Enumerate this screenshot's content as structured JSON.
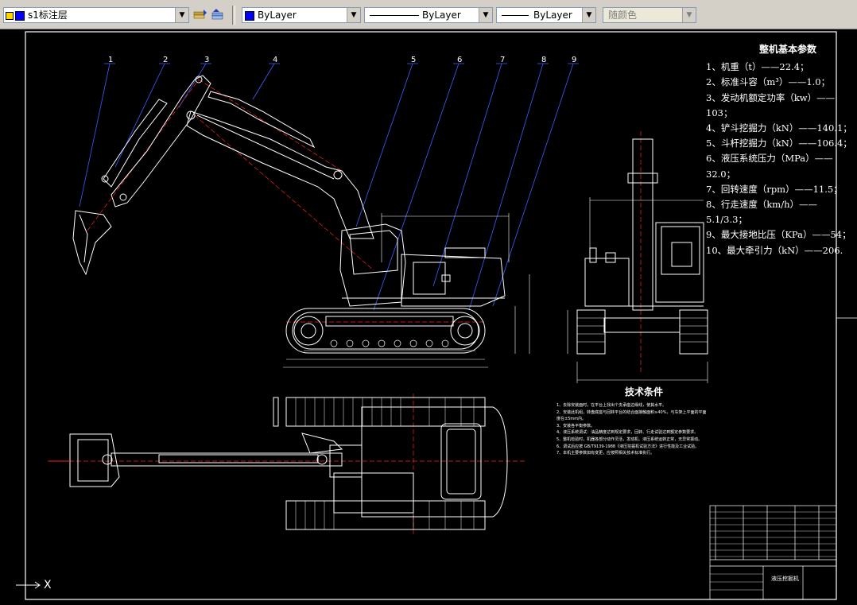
{
  "toolbar": {
    "layer_name": "s1标注层",
    "color": "ByLayer",
    "linetype": "ByLayer",
    "lineweight": "ByLayer",
    "plotstyle": "随颜色"
  },
  "drawing": {
    "part_numbers": [
      "1",
      "2",
      "3",
      "4",
      "5",
      "6",
      "7",
      "8",
      "9"
    ],
    "params_title": "整机基本参数",
    "params": [
      "1、机重（t）——22.4；",
      "2、标准斗容（m³）——1.0；",
      "3、发动机额定功率（kw）——103；",
      "4、铲斗挖掘力（kN）——140.1；",
      "5、斗杆挖掘力（kN）——106.4；",
      "6、液压系统压力（MPa）——32.0；",
      "7、回转速度（rpm）——11.5；",
      "8、行走速度（km/h）——5.1/3.3；",
      "9、最大接地比压（KPa）——54；",
      "10、最大牵引力（kN）——206."
    ],
    "tech_title": "技术条件",
    "tech_items": [
      "1、去除安装面时，在平台上找出个支承座边缘线，使其水平。",
      "2、安装此机组，转盘底座与回转平台的结合面接触面积≥40%，与车架上平面的平面度在±5mm内。",
      "3、安装各平衡参数。",
      "4、液压系统调试：油品精度达到规定要求，回转、行走试验达到额定参数要求。",
      "5、整机检验时，机器各部分动作灵活，发动机、液压系统运转正常，无异常振动。",
      "6、调试后应按 GB/T9139-1988《液压挖掘机试验方法》进行性能及工业试验。",
      "7、本机主要参数如有变更，应按照相关技术标准执行。"
    ],
    "title_block": "液压挖掘机",
    "cursor_label": "X"
  }
}
